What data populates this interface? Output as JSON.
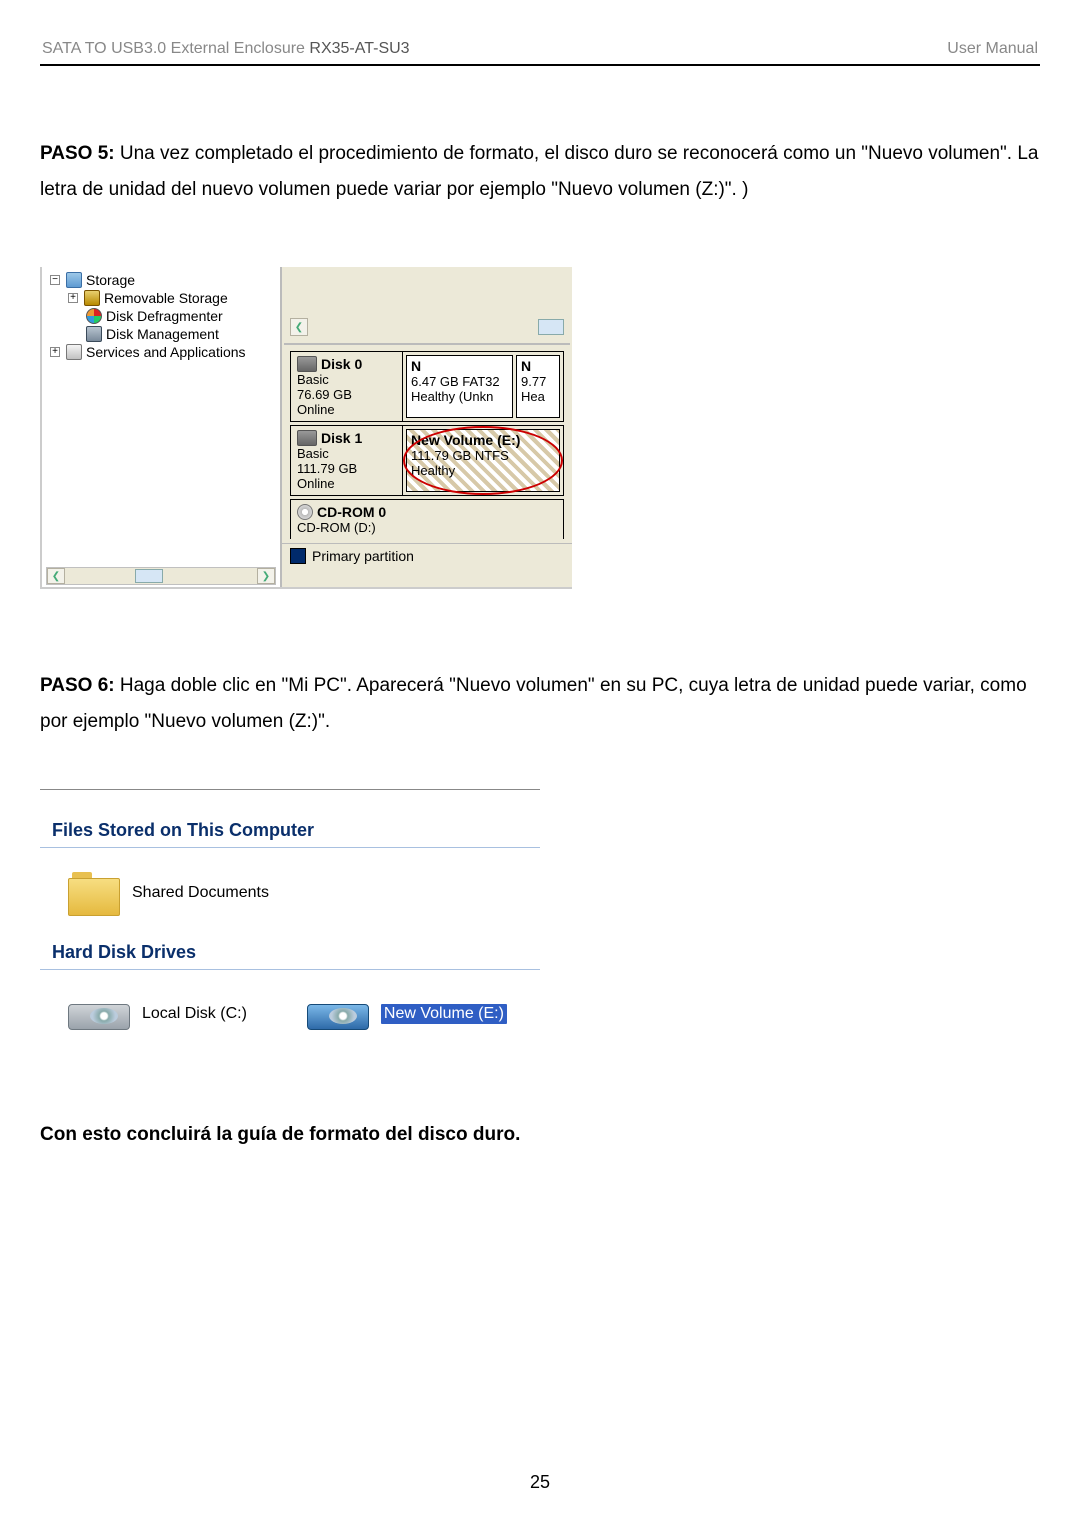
{
  "header": {
    "left_grey": "SATA TO USB3.0 External Enclosure",
    "left_model": "RX35-AT-SU3",
    "right": "User Manual"
  },
  "step5": {
    "label": "PASO 5:",
    "text": "Una vez completado el procedimiento de formato, el disco duro se reconocerá como un \"Nuevo volumen\". La letra de unidad del nuevo volumen puede variar por ejemplo \"Nuevo volumen (Z:)\". )"
  },
  "dm": {
    "tree": {
      "storage": "Storage",
      "removable": "Removable Storage",
      "defrag": "Disk Defragmenter",
      "diskmgmt": "Disk Management",
      "services": "Services and Applications"
    },
    "disk0": {
      "title": "Disk 0",
      "l1": "Basic",
      "l2": "76.69 GB",
      "l3": "Online",
      "vol1_h": "N",
      "vol1_l1": "6.47 GB FAT32",
      "vol1_l2": "Healthy (Unkn",
      "vol2_h": "N",
      "vol2_l1": "9.77",
      "vol2_l2": "Hea"
    },
    "disk1": {
      "title": "Disk 1",
      "l1": "Basic",
      "l2": "111.79 GB",
      "l3": "Online",
      "vol_h": "New Volume  (E:)",
      "vol_l1": "111.79 GB NTFS",
      "vol_l2": "Healthy"
    },
    "cdrom": {
      "title": "CD-ROM 0",
      "l1": "CD-ROM (D:)"
    },
    "legend": "Primary partition"
  },
  "step6": {
    "label": "PASO 6:",
    "text": "Haga doble clic en \"Mi PC\". Aparecerá \"Nuevo volumen\" en su PC, cuya letra de unidad puede variar, como por ejemplo \"Nuevo volumen (Z:)\"."
  },
  "mc": {
    "section1": "Files Stored on This Computer",
    "shared": "Shared Documents",
    "section2": "Hard Disk Drives",
    "localdisk": "Local Disk (C:)",
    "newvolume": "New Volume (E:)"
  },
  "conclusion": "Con esto concluirá la guía de formato del disco duro.",
  "page_number": "25"
}
